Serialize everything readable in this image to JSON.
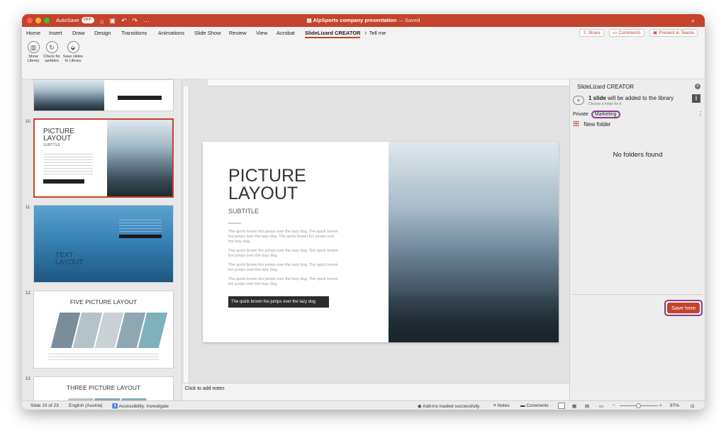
{
  "titlebar": {
    "autosave_label": "AutoSave",
    "autosave_state": "OFF",
    "document_title": "AlpSports company presentation",
    "saved_status": "— Saved",
    "colors": {
      "bar": "#c4432b"
    }
  },
  "ribbon": {
    "tabs": [
      "Home",
      "Insert",
      "Draw",
      "Design",
      "Transitions",
      "Animations",
      "Slide Show",
      "Review",
      "View",
      "Acrobat",
      "SlideLizard CREATOR"
    ],
    "active_tab": "SlideLizard CREATOR",
    "tell_me": "Tell me",
    "share": "Share",
    "comments": "Comments",
    "present": "Present in Teams"
  },
  "toolbar": {
    "show_library": "Show Library",
    "check_updates": "Check for updates",
    "save_slides": "Save slides to Library"
  },
  "thumbnails": {
    "slide_numbers": [
      "10",
      "11",
      "12",
      "13"
    ],
    "t10_title": "PICTURE LAYOUT",
    "t10_sub": "SUBTITLE",
    "t11_title": "TEXT LAYOUT",
    "t12_title": "FIVE PICTURE LAYOUT",
    "t13_title": "THREE PICTURE LAYOUT"
  },
  "slide": {
    "title_line1": "PICTURE",
    "title_line2": "LAYOUT",
    "subtitle": "SUBTITLE",
    "paragraphs": [
      "The quick brown fox jumps over the lazy dog. The quick brown fox jumps over the lazy dog. The quick brown fox jumps over the lazy dog.",
      "The quick brown fox jumps over the lazy dog. The quick brown fox jumps over the lazy dog.",
      "The quick brown fox jumps over the lazy dog. The quick brown fox jumps over the lazy dog.",
      "The quick brown fox jumps over the lazy dog. The quick brown fox jumps over the lazy dog."
    ],
    "callout": "The quick brown fox jumps over the lazy dog."
  },
  "notes": {
    "placeholder": "Click to add notes"
  },
  "panel": {
    "title": "SlideLizard CREATOR",
    "count_bold": "1 slide",
    "count_rest": "will be added to the library",
    "choose_hint": "Choose a folder for it",
    "crumb_private": "Private",
    "crumb_marketing": "Marketing",
    "new_folder": "New folder",
    "empty": "No folders found",
    "save_button": "Save here",
    "colors": {
      "accent": "#8b3a8f",
      "save_bg": "#c4432b"
    }
  },
  "status": {
    "slide_of": "Slide 10 of 23",
    "language": "English (Austria)",
    "accessibility": "Accessibility: Investigate",
    "addins": "Add-ins loaded successfully",
    "notes": "Notes",
    "comments": "Comments",
    "zoom": "97%"
  }
}
